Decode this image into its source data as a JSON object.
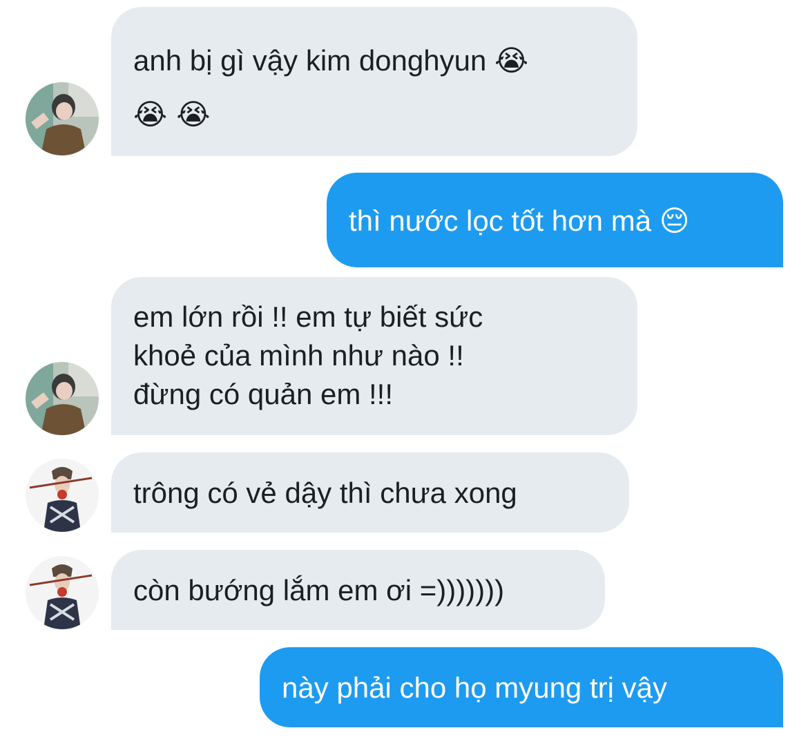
{
  "conversation": {
    "messages": [
      {
        "direction": "incoming",
        "avatar": "avatar-a",
        "lines": [
          "anh bị gì vậy kim donghyun 😭",
          "😭 😭"
        ]
      },
      {
        "direction": "outgoing",
        "lines": [
          "thì nước lọc tốt hơn mà 😔"
        ]
      },
      {
        "direction": "incoming",
        "avatar": "avatar-a",
        "lines": [
          "em lớn rồi !! em tự biết sức",
          "khoẻ của mình như nào !!",
          "đừng có quản em !!!"
        ]
      },
      {
        "direction": "incoming",
        "avatar": "avatar-b",
        "lines": [
          "trông có vẻ dậy thì chưa xong"
        ]
      },
      {
        "direction": "incoming",
        "avatar": "avatar-b",
        "lines": [
          "còn bướng lắm em ơi =)))))))"
        ]
      },
      {
        "direction": "outgoing",
        "lines": [
          "này phải cho họ myung trị vậy"
        ]
      }
    ]
  },
  "colors": {
    "incoming_bubble": "#e6ebf0",
    "outgoing_bubble": "#1d9bf0",
    "incoming_text": "#1c1e21",
    "outgoing_text": "#ffffff"
  },
  "icons": {
    "avatar-a": "profile-photo-avatar",
    "avatar-b": "profile-photo-avatar"
  }
}
